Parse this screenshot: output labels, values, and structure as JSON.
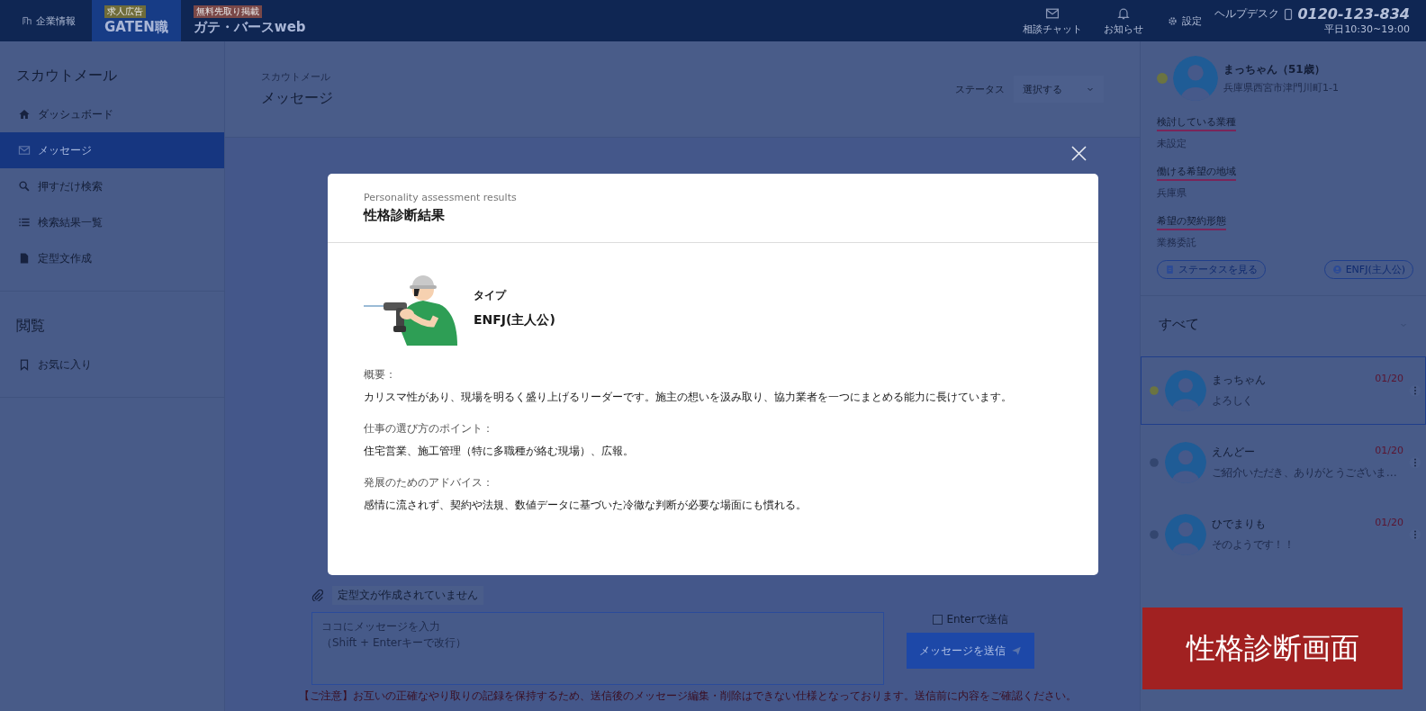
{
  "header": {
    "company_link": "企業情報",
    "logos": [
      {
        "badge": "求人広告",
        "name": "GATEN職",
        "selected": true
      },
      {
        "badge": "無料先取り掲載",
        "name": "ガテ・バースweb",
        "selected": false
      }
    ],
    "nav": [
      {
        "kind": "mail",
        "label": "相談チャット"
      },
      {
        "kind": "bell",
        "label": "お知らせ"
      }
    ],
    "settings": "設定",
    "helpdesk": {
      "label": "ヘルプデスク",
      "phone": "0120-123-834",
      "hours": "平日10:30~19:00"
    }
  },
  "sidebar": {
    "sections": [
      {
        "title": "スカウトメール",
        "items": [
          {
            "kind": "home",
            "label": "ダッシュボード",
            "selected": false
          },
          {
            "kind": "mail",
            "label": "メッセージ",
            "selected": true
          },
          {
            "kind": "search",
            "label": "押すだけ検索",
            "selected": false
          },
          {
            "kind": "list",
            "label": "検索結果一覧",
            "selected": false
          },
          {
            "kind": "doc",
            "label": "定型文作成",
            "selected": false
          }
        ]
      },
      {
        "title": "閲覧",
        "items": [
          {
            "kind": "bookmark",
            "label": "お気に入り",
            "selected": false
          }
        ]
      }
    ]
  },
  "page_header": {
    "breadcrumb": "スカウトメール",
    "title": "メッセージ",
    "status_label": "ステータス",
    "status_select": "選択する"
  },
  "composer": {
    "template": "定型文が作成されていません",
    "placeholder": [
      "ココにメッセージを入力",
      "（Shift + Enterキーで改行）"
    ],
    "enter_to_send": {
      "label": "Enterで送信",
      "checked": false
    },
    "send_button": "メッセージを送信",
    "notice": "【ご注意】お互いの正確なやり取りの記録を保持するため、送信後のメッセージ編集・削除はできない仕様となっております。送信前に内容をご確認ください。"
  },
  "profile": {
    "name": "まっちゃん（51歳）",
    "address": "兵庫県西宮市津門川町1-1",
    "fields": [
      {
        "label": "検討している業種",
        "value": "未設定"
      },
      {
        "label": "働ける希望の地域",
        "value": "兵庫県"
      },
      {
        "label": "希望の契約形態",
        "value": "業務委託"
      }
    ],
    "buttons": [
      {
        "kind": "status",
        "label": "ステータスを見る"
      },
      {
        "kind": "type",
        "label": "ENFJ(主人公)"
      }
    ]
  },
  "conversations": {
    "filter": "すべて",
    "items": [
      {
        "name": "まっちゃん",
        "date": "01/20",
        "preview": "よろしく",
        "selected": true,
        "starred": true
      },
      {
        "name": "えんどー",
        "date": "01/20",
        "preview": "ご紹介いただき、ありがとうございま…",
        "selected": false,
        "starred": false
      },
      {
        "name": "ひでまりも",
        "date": "01/20",
        "preview": "そのようです！！",
        "selected": false,
        "starred": false
      }
    ]
  },
  "modal": {
    "subtitle": "Personality assessment results",
    "title": "性格診断結果",
    "type_label": "タイプ",
    "type": "ENFJ(主人公)",
    "sections": [
      {
        "heading": "概要：",
        "body": "カリスマ性があり、現場を明るく盛り上げるリーダーです。施主の想いを汲み取り、協力業者を一つにまとめる能力に長けています。"
      },
      {
        "heading": "仕事の選び方のポイント：",
        "body": "住宅営業、施工管理（特に多職種が絡む現場）、広報。"
      },
      {
        "heading": "発展のためのアドバイス：",
        "body": "感情に流されず、契約や法規、数値データに基づいた冷徹な判断が必要な場面にも慣れる。"
      }
    ]
  },
  "caption": "性格診断画面"
}
